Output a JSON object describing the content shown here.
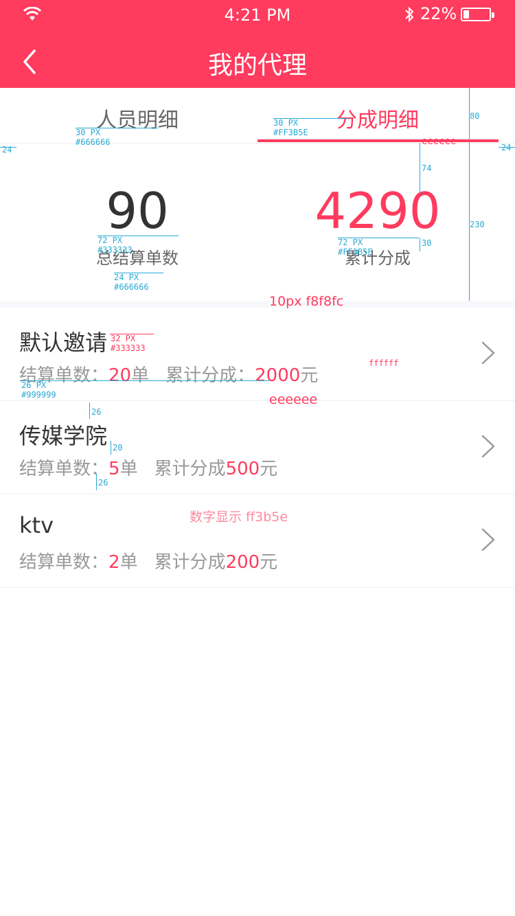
{
  "status_bar": {
    "time": "4:21 PM",
    "battery": "22%",
    "battery_level": 0.22
  },
  "header": {
    "title": "我的代理",
    "back_icon": "chevron-left-icon",
    "background": "#ff3b5e"
  },
  "tabs": [
    {
      "label": "人员明细",
      "active": false
    },
    {
      "label": "分成明细",
      "active": true
    }
  ],
  "stats": {
    "left": {
      "value": "90",
      "label": "总结算单数"
    },
    "right": {
      "value": "4290",
      "label": "累计分成"
    }
  },
  "list": [
    {
      "name": "默认邀请",
      "orders_label": "结算单数：",
      "orders_value": "20",
      "orders_unit": "单",
      "share_label": "累计分成：",
      "share_value": "2000",
      "share_unit": "元"
    },
    {
      "name": "传媒学院",
      "orders_label": "结算单数：",
      "orders_value": "5",
      "orders_unit": "单",
      "share_label": "累计分成",
      "share_value": "500",
      "share_unit": "元"
    },
    {
      "name": "ktv",
      "orders_label": "结算单数：",
      "orders_value": "2",
      "orders_unit": "单",
      "share_label": "累计分成",
      "share_value": "200",
      "share_unit": "元"
    }
  ],
  "annotations": {
    "tab_left_font": "30 PX",
    "tab_left_color": "#666666",
    "tab_right_font": "30 PX",
    "tab_right_color": "#FF3B5E",
    "margin_left": "24",
    "margin_right": "24",
    "tab_height": "80",
    "divider_color": "eeeeee",
    "stat_top": "74",
    "stat_block_height": "230",
    "stat_left_font": "72 PX",
    "stat_left_color": "#333333",
    "stat_right_font": "72 PX",
    "stat_right_color": "#FF3B5E",
    "stat_gap": "30",
    "stat_label_font": "24 PX",
    "stat_label_color": "#666666",
    "gap_note": "10px   f8f8fc",
    "name_font": "32 PX",
    "name_color": "#333333",
    "bg_white": "ffffff",
    "detail_font": "26 PX",
    "detail_color": "#999999",
    "row_border": "eeeeee",
    "spacing_26_top": "26",
    "spacing_20": "20",
    "spacing_26_bottom": "26",
    "number_note": "数字显示 ff3b5e"
  },
  "colors": {
    "accent": "#ff3b5e",
    "text_dark": "#333333",
    "text_mid": "#666666",
    "text_light": "#999999",
    "divider": "#eeeeee",
    "gap_bg": "#f8f8fc",
    "annotation": "#29a9d6"
  }
}
